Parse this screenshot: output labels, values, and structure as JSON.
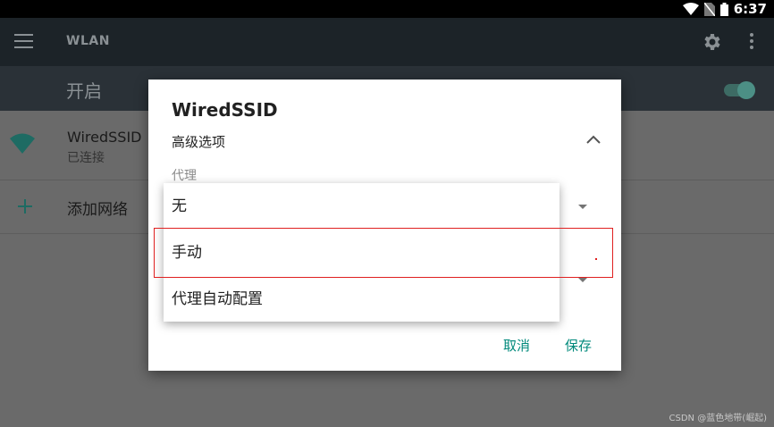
{
  "status_bar": {
    "time": "6:37"
  },
  "toolbar": {
    "title": "WLAN"
  },
  "switch_bar": {
    "label": "开启",
    "enabled": true
  },
  "networks": [
    {
      "name": "WiredSSID",
      "status": "已连接"
    }
  ],
  "add_network": {
    "label": "添加网络"
  },
  "dialog": {
    "title": "WiredSSID",
    "advanced_label": "高级选项",
    "proxy_label": "代理",
    "cancel_label": "取消",
    "save_label": "保存"
  },
  "proxy_dropdown": {
    "options": [
      "无",
      "手动",
      "代理自动配置"
    ],
    "highlighted": "手动"
  },
  "watermark": "CSDN @蓝色地带(崛起)",
  "colors": {
    "accent": "#00897b",
    "highlight_border": "#e02020"
  }
}
